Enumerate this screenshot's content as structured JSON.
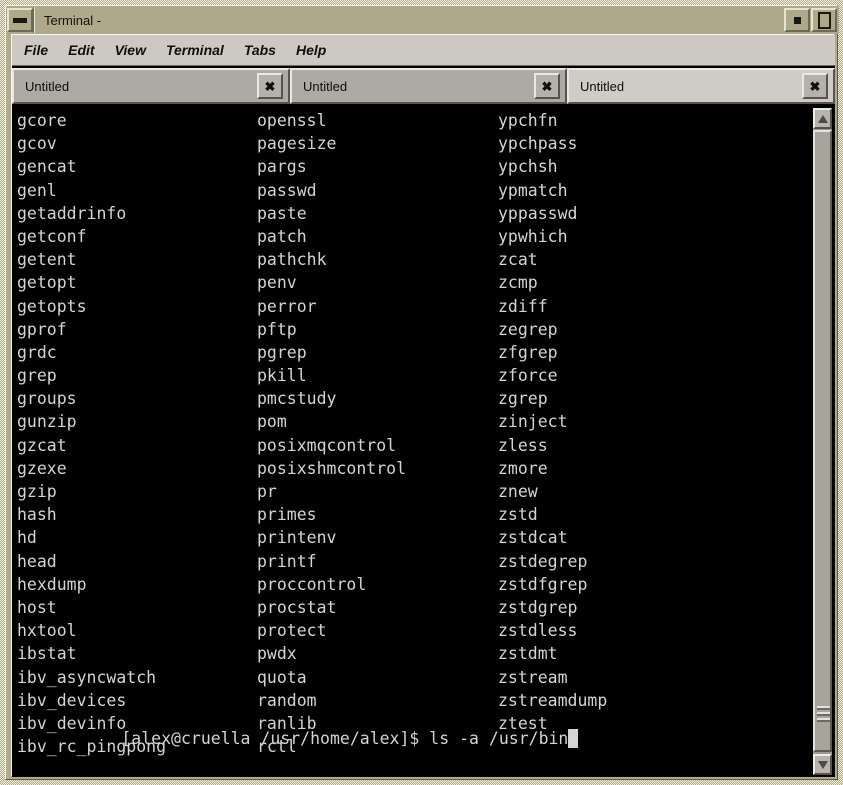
{
  "window": {
    "title": "Terminal -",
    "minimize_icon": "minimize-icon",
    "maximize_icon": "maximize-icon",
    "restore_icon": "restore-icon"
  },
  "menu": {
    "items": [
      {
        "label": "File"
      },
      {
        "label": "Edit"
      },
      {
        "label": "View"
      },
      {
        "label": "Terminal"
      },
      {
        "label": "Tabs"
      },
      {
        "label": "Help"
      }
    ]
  },
  "tabs": {
    "close_label": "✖",
    "items": [
      {
        "label": "Untitled",
        "active": false
      },
      {
        "label": "Untitled",
        "active": false
      },
      {
        "label": "Untitled",
        "active": true
      }
    ]
  },
  "terminal": {
    "columns": [
      [
        "gcore",
        "gcov",
        "gencat",
        "genl",
        "getaddrinfo",
        "getconf",
        "getent",
        "getopt",
        "getopts",
        "gprof",
        "grdc",
        "grep",
        "groups",
        "gunzip",
        "gzcat",
        "gzexe",
        "gzip",
        "hash",
        "hd",
        "head",
        "hexdump",
        "host",
        "hxtool",
        "ibstat",
        "ibv_asyncwatch",
        "ibv_devices",
        "ibv_devinfo",
        "ibv_rc_pingpong"
      ],
      [
        "openssl",
        "pagesize",
        "pargs",
        "passwd",
        "paste",
        "patch",
        "pathchk",
        "penv",
        "perror",
        "pftp",
        "pgrep",
        "pkill",
        "pmcstudy",
        "pom",
        "posixmqcontrol",
        "posixshmcontrol",
        "pr",
        "primes",
        "printenv",
        "printf",
        "proccontrol",
        "procstat",
        "protect",
        "pwdx",
        "quota",
        "random",
        "ranlib",
        "rctl"
      ],
      [
        "ypchfn",
        "ypchpass",
        "ypchsh",
        "ypmatch",
        "yppasswd",
        "ypwhich",
        "zcat",
        "zcmp",
        "zdiff",
        "zegrep",
        "zfgrep",
        "zforce",
        "zgrep",
        "zinject",
        "zless",
        "zmore",
        "znew",
        "zstd",
        "zstdcat",
        "zstdegrep",
        "zstdfgrep",
        "zstdgrep",
        "zstdless",
        "zstdmt",
        "zstream",
        "zstreamdump",
        "ztest",
        ""
      ]
    ],
    "prompt": "[alex@cruella /usr/home/alex]$ ",
    "command": "ls -a /usr/bin"
  },
  "scrollbar": {
    "up_icon": "scroll-up-arrow-icon",
    "down_icon": "scroll-down-arrow-icon"
  }
}
